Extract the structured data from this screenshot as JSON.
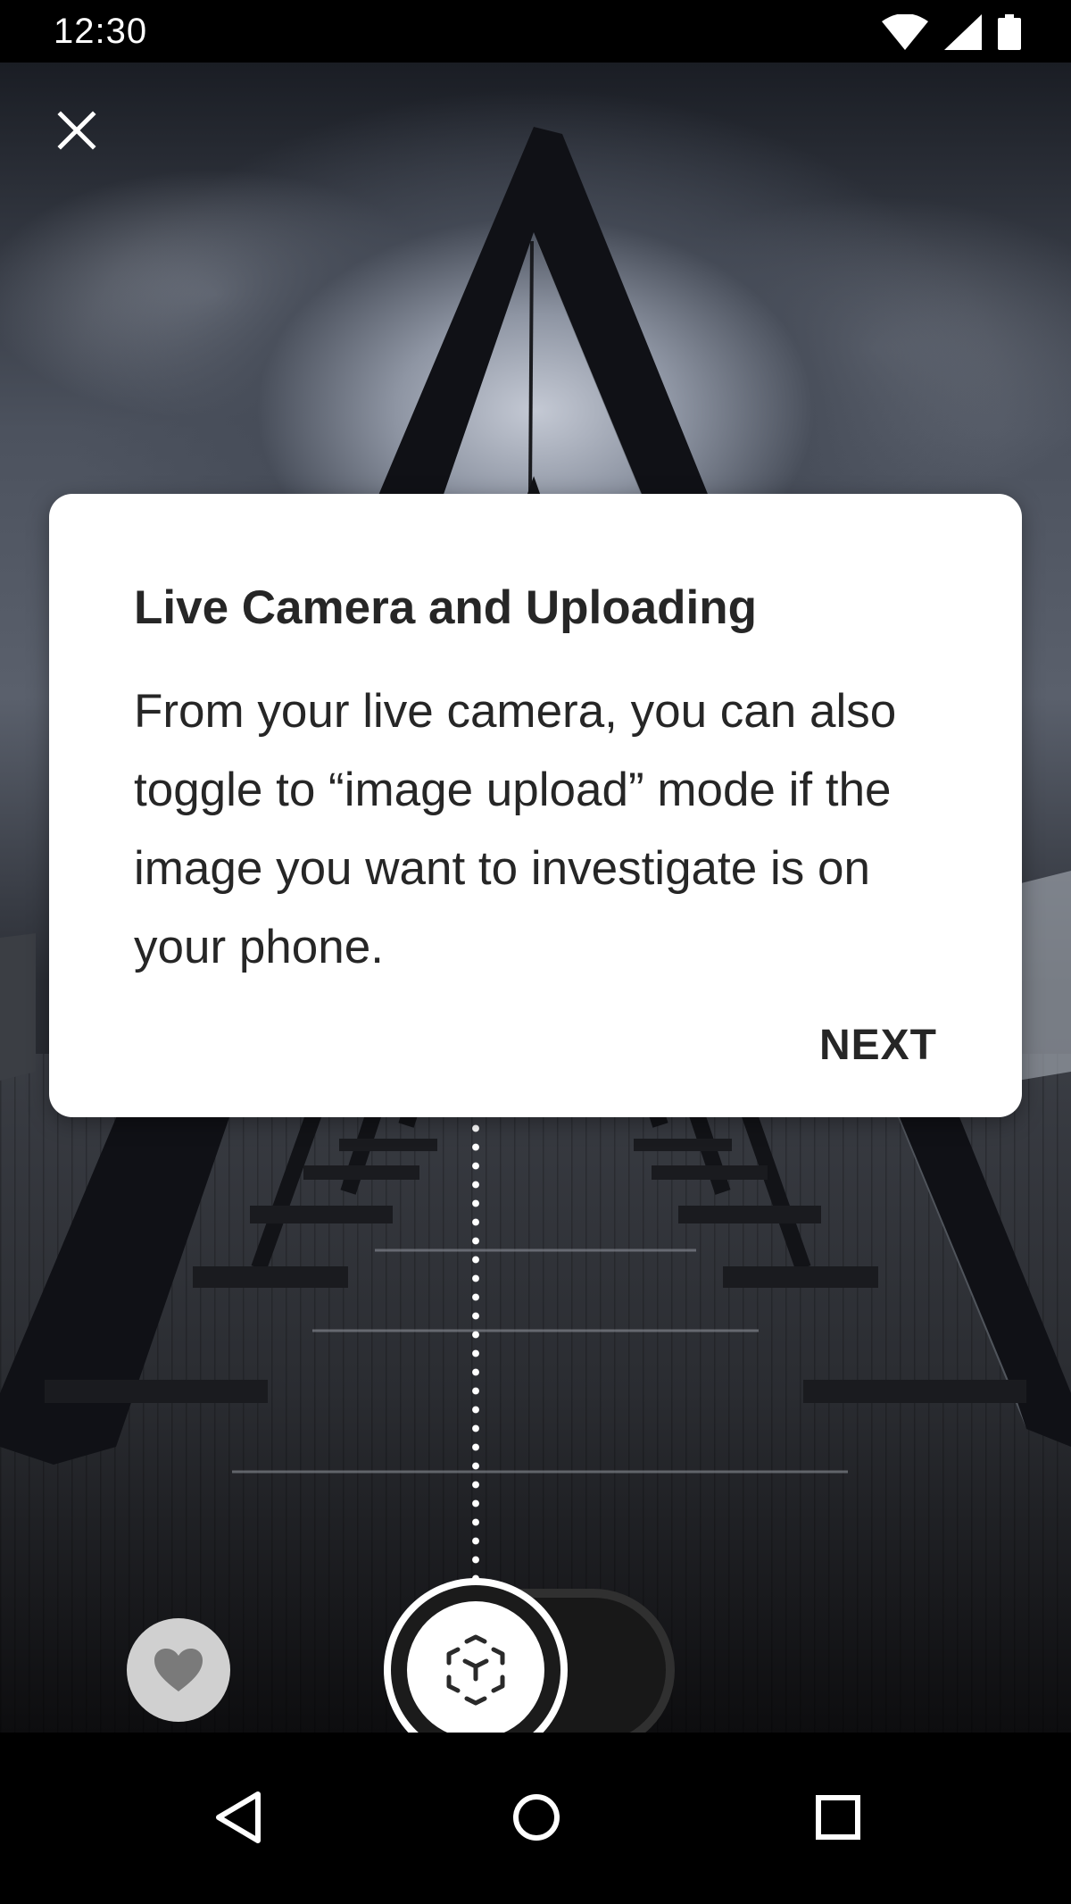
{
  "status_bar": {
    "time": "12:30",
    "icons": [
      "wifi-icon",
      "cell-signal-icon",
      "battery-icon"
    ]
  },
  "top_bar": {
    "close_icon": "close-icon"
  },
  "onboarding_card": {
    "title": "Live Camera and Uploading",
    "body": "From your live camera, you can also toggle to “image upload” mode if the image you want to investigate is on your phone.",
    "next_label": "NEXT"
  },
  "bottom_controls": {
    "favorites_icon": "heart-icon",
    "shutter_icon": "ar-cube-icon",
    "mode_toggle": "live-camera-image-upload-toggle"
  },
  "nav_bar": {
    "buttons": [
      "back-icon",
      "home-icon",
      "recents-icon"
    ]
  },
  "colors": {
    "card_background": "#ffffff",
    "card_text": "#262626",
    "favorites_button": "#d0d0d0",
    "shutter_ring": "#1b1b1b"
  }
}
